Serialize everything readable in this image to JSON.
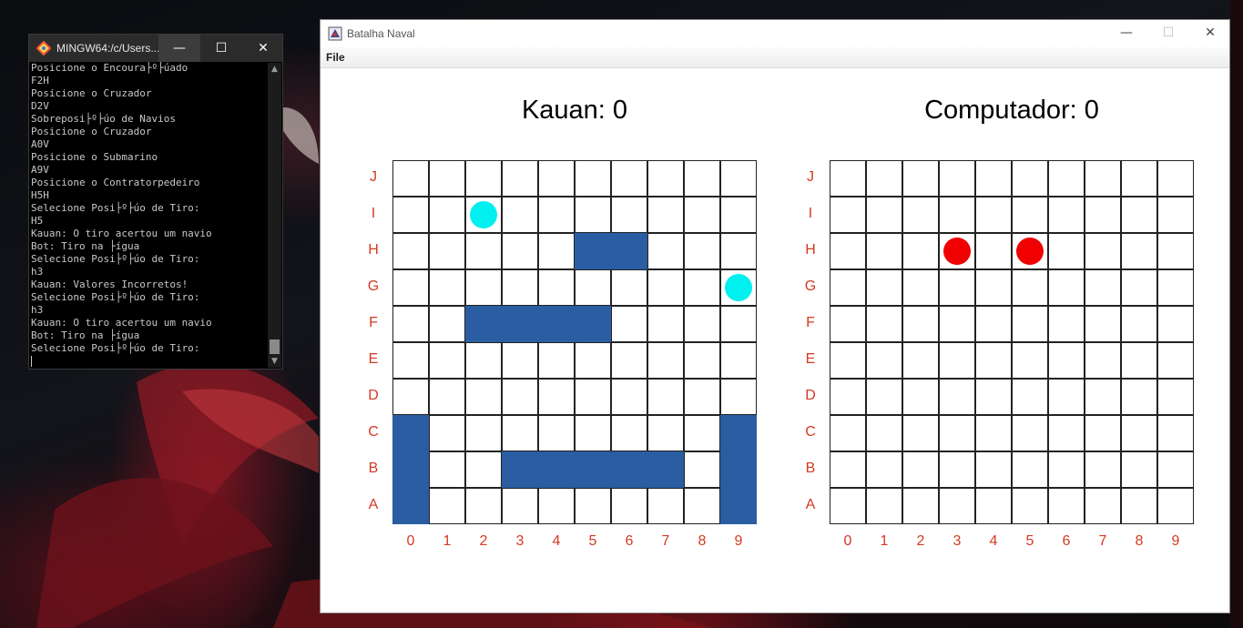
{
  "terminal": {
    "title": "MINGW64:/c/Users...",
    "lines": [
      "Posicione o Encoura├º├úado",
      "F2H",
      "Posicione o Cruzador",
      "D2V",
      "Sobreposi├º├úo de Navios",
      "Posicione o Cruzador",
      "A0V",
      "Posicione o Submarino",
      "A9V",
      "Posicione o Contratorpedeiro",
      "H5H",
      "Selecione Posi├º├úo de Tiro:",
      "H5",
      "Kauan: O tiro acertou um navio",
      "Bot: Tiro na ├ígua",
      "Selecione Posi├º├úo de Tiro:",
      "h3",
      "Kauan: Valores Incorretos!",
      "Selecione Posi├º├úo de Tiro:",
      "h3",
      "Kauan: O tiro acertou um navio",
      "Bot: Tiro na ├ígua",
      "Selecione Posi├º├úo de Tiro:"
    ]
  },
  "game": {
    "title": "Batalha Naval",
    "menu": {
      "file": "File"
    },
    "player": {
      "score_label": "Kauan: 0"
    },
    "computer": {
      "score_label": "Computador: 0"
    },
    "row_labels": [
      "J",
      "I",
      "H",
      "G",
      "F",
      "E",
      "D",
      "C",
      "B",
      "A"
    ],
    "col_labels": [
      "0",
      "1",
      "2",
      "3",
      "4",
      "5",
      "6",
      "7",
      "8",
      "9"
    ],
    "colors": {
      "ship": "#2a5da1",
      "miss": "#00f0f0",
      "hit": "#f00000",
      "label": "#d43a22"
    },
    "player_ships": [
      {
        "row": "H",
        "col": 5,
        "length": 2,
        "orientation": "horizontal"
      },
      {
        "row": "F",
        "col": 2,
        "length": 4,
        "orientation": "horizontal"
      },
      {
        "row": "B",
        "col": 3,
        "length": 5,
        "orientation": "horizontal"
      },
      {
        "row": "A",
        "col": 0,
        "length": 3,
        "orientation": "vertical"
      },
      {
        "row": "A",
        "col": 9,
        "length": 3,
        "orientation": "vertical"
      }
    ],
    "player_shots": [
      {
        "row": "I",
        "col": 2,
        "result": "miss"
      },
      {
        "row": "G",
        "col": 9,
        "result": "miss"
      }
    ],
    "computer_shots": [
      {
        "row": "H",
        "col": 3,
        "result": "hit"
      },
      {
        "row": "H",
        "col": 5,
        "result": "hit"
      }
    ]
  }
}
